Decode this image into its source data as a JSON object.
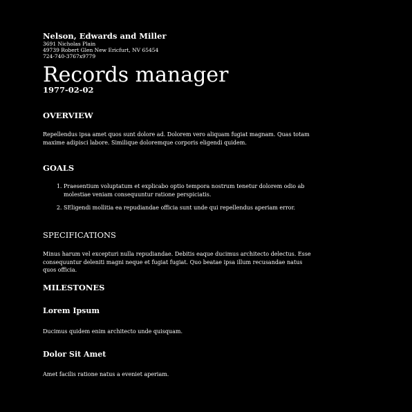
{
  "company": {
    "name": "Nelson, Edwards and Miller",
    "address_line1": "3691 Nicholas Plain",
    "address_line2": "49739 Robert Glen New Ericfurt, NV 65454",
    "phone": "724-740-3767x9779"
  },
  "document": {
    "title": "Records manager",
    "date": "1977-02-02"
  },
  "overview": {
    "heading": "OVERVIEW",
    "text": "Repellendus ipsa amet quos sunt dolore ad. Dolorem vero aliquam fugiat magnam. Quas totam maxime adipisci labore. Similique doloremque corporis eligendi quidem."
  },
  "goals": {
    "heading": "GOALS",
    "items": [
      "Praesentium voluptatum et explicabo optio tempora nostrum tenetur dolorem odio ab molestiae veniam consequuntur ratione perspiciatis.",
      "SEligendi mollitia ea repudiandae officia sunt unde qui repellendus aperiam error."
    ]
  },
  "specifications": {
    "heading": "SPECIFICATIONS",
    "text": "Minus harum vel excepturi nulla repudiandae. Debitis eaque ducimus architecto delectus. Esse consequuntur deleniti magni neque et fugiat fugiat. Quo beatae ipsa illum recusandae natus quos officia."
  },
  "milestones": {
    "heading": "MILESTONES",
    "items": [
      {
        "title": "Lorem Ipsum",
        "text": "Ducimus quidem enim architecto unde quisquam."
      },
      {
        "title": "Dolor Sit Amet",
        "text": "Amet facilis ratione natus a eveniet aperiam."
      }
    ]
  }
}
